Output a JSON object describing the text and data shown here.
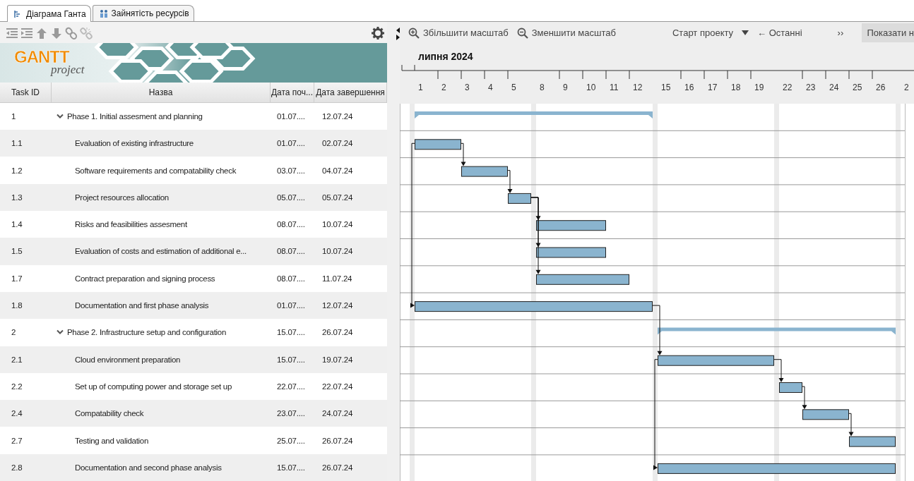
{
  "tabs": [
    {
      "label": "Діаграма Ганта",
      "kind": "gantt",
      "selected": true
    },
    {
      "label": "Зайнятість ресурсів",
      "kind": "resources",
      "selected": false
    }
  ],
  "logo": {
    "title": "GANTT",
    "subtitle": "project"
  },
  "table": {
    "columns": [
      "Task ID",
      "Назва",
      "Дата поч...",
      "Дата завершення"
    ],
    "rows": [
      {
        "id": "1",
        "name": "Phase 1. Initial assesment and planning",
        "start": "01.07....",
        "end": "12.07.24",
        "kind": "phase",
        "expanded": true
      },
      {
        "id": "1.1",
        "name": "Evaluation of existing infrastructure",
        "start": "01.07....",
        "end": "02.07.24",
        "kind": "task"
      },
      {
        "id": "1.2",
        "name": "Software requirements and compatability check",
        "start": "03.07....",
        "end": "04.07.24",
        "kind": "task",
        "link": {
          "kind": "finish_prev"
        }
      },
      {
        "id": "1.3",
        "name": "Project resources allocation",
        "start": "05.07....",
        "end": "05.07.24",
        "kind": "task",
        "link": {
          "kind": "finish_prev"
        }
      },
      {
        "id": "1.4",
        "name": "Risks and feasibilities assesment",
        "start": "08.07....",
        "end": "10.07.24",
        "kind": "task",
        "link": {
          "kind": "finish_prev"
        }
      },
      {
        "id": "1.5",
        "name": "Evaluation of costs and estimation of additional e...",
        "start": "08.07....",
        "end": "10.07.24",
        "kind": "task",
        "link": {
          "kind": "finish_same"
        }
      },
      {
        "id": "1.7",
        "name": "Contract preparation and signing process",
        "start": "08.07....",
        "end": "11.07.24",
        "kind": "task",
        "link": {
          "kind": "finish_same"
        }
      },
      {
        "id": "1.8",
        "name": "Documentation and first phase analysis",
        "start": "01.07....",
        "end": "12.07.24",
        "kind": "task",
        "link": {
          "kind": "start_first"
        }
      },
      {
        "id": "2",
        "name": "Phase 2. Infrastructure setup and configuration",
        "start": "15.07....",
        "end": "26.07.24",
        "kind": "phase",
        "expanded": true
      },
      {
        "id": "2.1",
        "name": "Cloud environment preparation",
        "start": "15.07....",
        "end": "19.07.24",
        "kind": "task",
        "link": {
          "kind": "finish_prev"
        }
      },
      {
        "id": "2.2",
        "name": "Set up of computing power and storage set up",
        "start": "22.07....",
        "end": "22.07.24",
        "kind": "task",
        "link": {
          "kind": "finish_prev"
        }
      },
      {
        "id": "2.4",
        "name": "Compatability check",
        "start": "23.07....",
        "end": "24.07.24",
        "kind": "task",
        "link": {
          "kind": "finish_prev"
        }
      },
      {
        "id": "2.7",
        "name": "Testing and validation",
        "start": "25.07....",
        "end": "26.07.24",
        "kind": "task",
        "link": {
          "kind": "finish_prev"
        }
      },
      {
        "id": "2.8",
        "name": "Documentation and second phase analysis",
        "start": "15.07....",
        "end": "26.07.24",
        "kind": "task",
        "link": {
          "kind": "start_first"
        }
      }
    ]
  },
  "chart_toolbar": {
    "zoom_in": "Збільшити масштаб",
    "zoom_out": "Зменшити масштаб",
    "project_start": "Старт проекту",
    "recent": "← Останні",
    "next": "››",
    "show": "Показати н"
  },
  "timeline": {
    "month": "липня 2024",
    "days": [
      "1",
      "2",
      "3",
      "4",
      "5",
      "8",
      "9",
      "10",
      "11",
      "12",
      "15",
      "16",
      "17",
      "18",
      "19",
      "22",
      "23",
      "24",
      "25",
      "26",
      "2"
    ]
  }
}
